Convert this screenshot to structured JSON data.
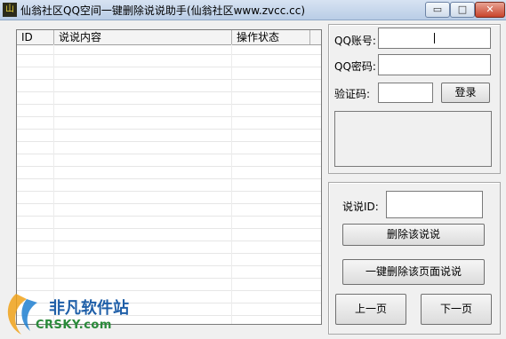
{
  "window": {
    "title": "仙翁社区QQ空间一键删除说说助手(仙翁社区www.zvcc.cc)",
    "icon": "app-icon",
    "min_glyph": "▭",
    "max_glyph": "□",
    "close_glyph": "✕"
  },
  "list": {
    "columns": [
      "ID",
      "说说内容",
      "操作状态"
    ]
  },
  "login": {
    "qq_label": "QQ账号:",
    "qq_value": "",
    "pwd_label": "QQ密码:",
    "pwd_value": "",
    "captcha_label": "验证码:",
    "captcha_value": "",
    "login_button": "登录"
  },
  "delete": {
    "id_label": "说说ID:",
    "id_value": "",
    "delete_button": "删除该说说",
    "delete_page_button": "一键删除该页面说说",
    "prev_button": "上一页",
    "next_button": "下一页"
  },
  "watermark": {
    "brand": "非凡软件站",
    "domain": "CRSKY.com"
  }
}
